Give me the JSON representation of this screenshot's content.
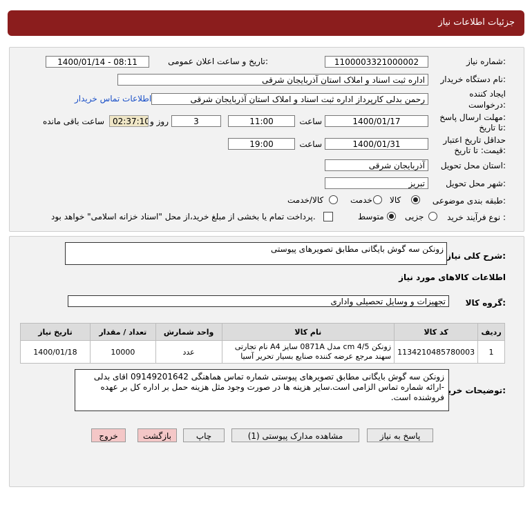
{
  "header": {
    "title": "جزئیات اطلاعات نیاز"
  },
  "info": {
    "need_number_label": "شماره نیاز:",
    "need_number": "1100003321000002",
    "announce_label": "تاریخ و ساعت اعلان عمومی:",
    "announce_value": "1400/01/14 - 08:11",
    "buyer_org_label": "نام دستگاه خریدار:",
    "buyer_org": "اداره ثبت اسناد و املاک استان آذربایجان شرقی",
    "creator_label_1": "ایجاد کننده",
    "creator_label_2": "درخواست:",
    "creator": "رحمن بدلی کارپرداز اداره ثبت اسناد و املاک استان آذربایجان شرقی",
    "contact_link": "اطلاعات تماس خریدار",
    "deadline_label_1": "مهلت ارسال پاسخ:",
    "deadline_label_2": "تا تاریخ:",
    "deadline_date": "1400/01/17",
    "time_label": "ساعت",
    "deadline_time": "11:00",
    "days_value": "3",
    "days_label": "روز و",
    "remaining_time": "02:37:10",
    "remaining_label": "ساعت باقی مانده",
    "validity_label_1": "حداقل تاریخ اعتبار",
    "validity_label_2": "قیمت: تا تاریخ:",
    "validity_date": "1400/01/31",
    "validity_time_label": "ساعت",
    "validity_time": "19:00",
    "province_label": "استان محل تحویل:",
    "province": "آذربایجان شرقی",
    "city_label": "شهر محل تحویل:",
    "city": "تبریز",
    "category_label": "طبقه بندی موضوعی:",
    "category_options": [
      "کالا",
      "خدمت",
      "کالا/خدمت"
    ],
    "process_label": "نوع فرآیند خرید :",
    "process_options": [
      "جزیی",
      "متوسط"
    ],
    "payment_note": "پرداخت تمام یا بخشی از مبلغ خرید،از محل \"اسناد خزانه اسلامی\" خواهد بود."
  },
  "summary": {
    "label": "شرح کلی نیاز:",
    "value": "زونکن سه گوش بایگانی مطابق تصویرهای پیوستی"
  },
  "goods": {
    "section_title": "اطلاعات کالاهای مورد نیاز",
    "group_label": "گروه کالا:",
    "group_value": "تجهیزات و وسایل تحصیلی واداری",
    "columns": [
      "ردیف",
      "کد کالا",
      "نام کالا",
      "واحد شمارش",
      "تعداد / مقدار",
      "تاریخ نیاز"
    ],
    "rows": [
      {
        "row": "1",
        "code": "1134210485780003",
        "name": "زونکن 4/5 cm مدل 0871A سایز A4 نام تجارتی سهند مرجع عرضه کننده صنایع بسیار تحریر آسیا",
        "unit": "عدد",
        "qty": "10000",
        "date": "1400/01/18"
      }
    ]
  },
  "buyer_notes": {
    "label": "توضیحات خریدار:",
    "value": "زونکن سه گوش بایگانی مطابق تصویرهای پیوستی شماره تماس هماهنگی 09149201642 اقای بدلی -ارائه شماره تماس الزامی است.سایر هزینه ها در صورت وجود مثل هزینه حمل بر اداره کل بر عهده فروشنده است."
  },
  "buttons": {
    "reply": "پاسخ به نیاز",
    "attachments": "مشاهده مدارک پیوستی (1)",
    "print": "چاپ",
    "back": "بازگشت",
    "exit": "خروج"
  }
}
